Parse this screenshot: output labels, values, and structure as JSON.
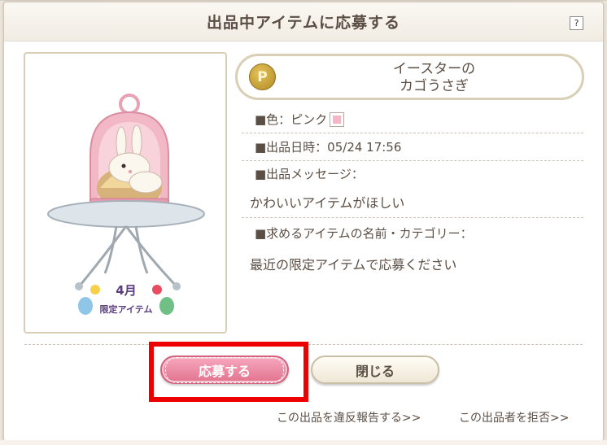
{
  "dialog": {
    "title": "出品中アイテムに応募する",
    "help_label": "?"
  },
  "item": {
    "currency_symbol": "P",
    "name_line1": "イースターの",
    "name_line2": "カゴうさぎ",
    "image_caption_month": "4月",
    "image_caption_limited": "限定アイテム",
    "color_label": "■色：ピンク",
    "color_value": "#f3b6c6",
    "listed_at_label": "■出品日時：05/24 17:56",
    "message_label": "■出品メッセージ：",
    "message_text": "かわいいアイテムがほしい",
    "wanted_label": "■求めるアイテムの名前・カテゴリー：",
    "wanted_text": "最近の限定アイテムで応募ください"
  },
  "actions": {
    "apply_label": "応募する",
    "close_label": "閉じる",
    "report_link": "この出品を違反報告する>>",
    "reject_link": "この出品者を拒否>>"
  },
  "colors": {
    "accent_pink": "#e2738f",
    "highlight": "#ee0000",
    "border_tan": "#d9cfb7"
  }
}
